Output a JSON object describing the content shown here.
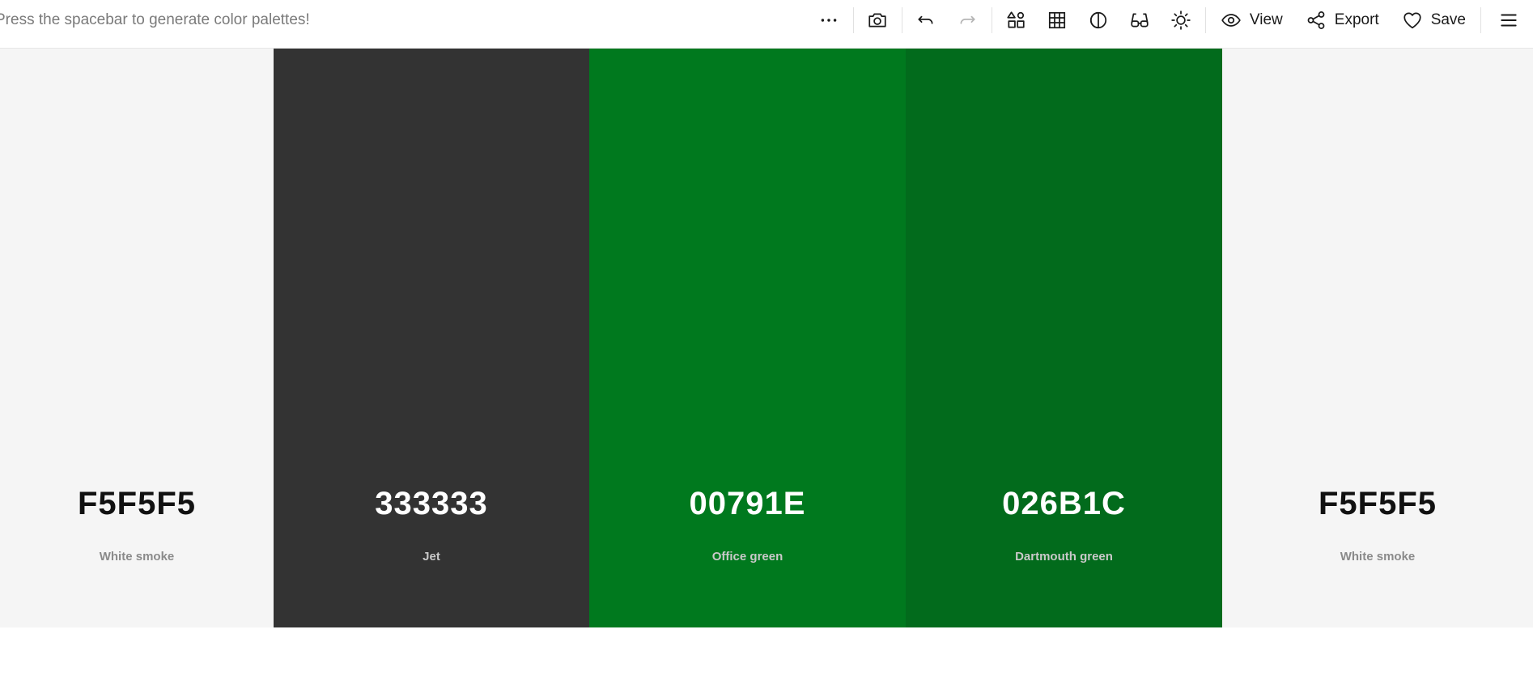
{
  "header": {
    "hint": "Press the spacebar to generate color palettes!"
  },
  "toolbar": {
    "more_icon": "more-horizontal-icon",
    "camera_icon": "camera-icon",
    "undo_icon": "undo-icon",
    "redo_icon": "redo-icon",
    "shapes_icon": "shapes-icon",
    "grid_icon": "grid-icon",
    "contrast_icon": "contrast-icon",
    "glasses_icon": "glasses-icon",
    "sun_icon": "sun-icon",
    "view_label": "View",
    "export_label": "Export",
    "save_label": "Save",
    "menu_icon": "hamburger-menu-icon"
  },
  "palette": {
    "swatches": [
      {
        "hex": "F5F5F5",
        "name": "White smoke",
        "color": "#F5F5F5",
        "tone": "light"
      },
      {
        "hex": "333333",
        "name": "Jet",
        "color": "#333333",
        "tone": "dark"
      },
      {
        "hex": "00791E",
        "name": "Office green",
        "color": "#00791E",
        "tone": "dark"
      },
      {
        "hex": "026B1C",
        "name": "Dartmouth green",
        "color": "#026B1C",
        "tone": "dark"
      },
      {
        "hex": "F5F5F5",
        "name": "White smoke",
        "color": "#F5F5F5",
        "tone": "light"
      }
    ]
  }
}
